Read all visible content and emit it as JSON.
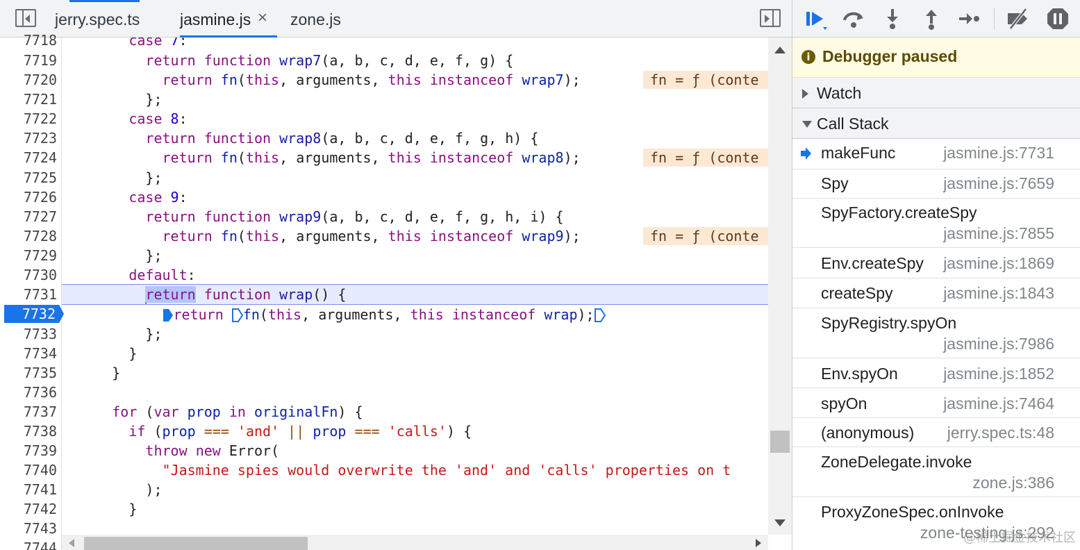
{
  "editor": {
    "tabs": [
      {
        "label": "jerry.spec.ts",
        "active": false
      },
      {
        "label": "jasmine.js",
        "active": true,
        "close": "×"
      },
      {
        "label": "zone.js",
        "active": false
      }
    ],
    "current_line": "7732",
    "lines": [
      {
        "n": "7718"
      },
      {
        "n": "7719"
      },
      {
        "n": "7720"
      },
      {
        "n": "7721"
      },
      {
        "n": "7722"
      },
      {
        "n": "7723"
      },
      {
        "n": "7724"
      },
      {
        "n": "7725"
      },
      {
        "n": "7726"
      },
      {
        "n": "7727"
      },
      {
        "n": "7728"
      },
      {
        "n": "7729"
      },
      {
        "n": "7730"
      },
      {
        "n": "7731"
      },
      {
        "n": "7732"
      },
      {
        "n": "7733"
      },
      {
        "n": "7734"
      },
      {
        "n": "7735"
      },
      {
        "n": "7736"
      },
      {
        "n": "7737"
      },
      {
        "n": "7738"
      },
      {
        "n": "7739"
      },
      {
        "n": "7740"
      },
      {
        "n": "7741"
      },
      {
        "n": "7742"
      },
      {
        "n": "7743"
      },
      {
        "n": "7744"
      }
    ],
    "inline_value": "fn = ƒ (conte",
    "code": {
      "l7718_a": "        case ",
      "l7718_b": "7",
      "l7718_c": ":",
      "l7719": {
        "indent": "          ",
        "return": "return",
        "function": "function",
        "name": "wrap7",
        "params": "(a, b, c, d, e, f, g) {"
      },
      "l7720": {
        "indent": "            ",
        "return": "return",
        "fn": "fn",
        "rest_a": "(",
        "this1": "this",
        "args": ", arguments, ",
        "this2": "this",
        "sp": " ",
        "instanceof": "instanceof",
        "sp2": " ",
        "name": "wrap7",
        "end": ");"
      },
      "l7721": "          };",
      "l7722_a": "        case ",
      "l7722_b": "8",
      "l7722_c": ":",
      "l7723": {
        "indent": "          ",
        "return": "return",
        "function": "function",
        "name": "wrap8",
        "params": "(a, b, c, d, e, f, g, h) {"
      },
      "l7724": {
        "indent": "            ",
        "return": "return",
        "fn": "fn",
        "rest_a": "(",
        "this1": "this",
        "args": ", arguments, ",
        "this2": "this",
        "sp": " ",
        "instanceof": "instanceof",
        "sp2": " ",
        "name": "wrap8",
        "end": ");"
      },
      "l7725": "          };",
      "l7726_a": "        case ",
      "l7726_b": "9",
      "l7726_c": ":",
      "l7727": {
        "indent": "          ",
        "return": "return",
        "function": "function",
        "name": "wrap9",
        "params": "(a, b, c, d, e, f, g, h, i) {"
      },
      "l7728": {
        "indent": "            ",
        "return": "return",
        "fn": "fn",
        "rest_a": "(",
        "this1": "this",
        "args": ", arguments, ",
        "this2": "this",
        "sp": " ",
        "instanceof": "instanceof",
        "sp2": " ",
        "name": "wrap9",
        "end": ");"
      },
      "l7729": "          };",
      "l7730_a": "        ",
      "l7730_b": "default",
      "l7730_c": ":",
      "l7731": {
        "indent": "          ",
        "return": "return",
        "function": "function",
        "name": "wrap",
        "params": "() {"
      },
      "l7732": {
        "indent": "            ",
        "return": "return ",
        "fn": "fn",
        "rest_a": "(",
        "this1": "this",
        "args": ", arguments, ",
        "this2": "this",
        "sp": " ",
        "instanceof": "instanceof",
        "sp2": " ",
        "name": "wrap",
        "end": ");"
      },
      "l7733": "          };",
      "l7734": "        }",
      "l7735": "      }",
      "l7737": {
        "indent": "      ",
        "for": "for",
        "p1": " (",
        "var": "var",
        "sp": " ",
        "prop": "prop",
        "sp2": " ",
        "in": "in",
        "sp3": " ",
        "obj": "originalFn",
        "end": ") {"
      },
      "l7738": {
        "indent": "        ",
        "if": "if",
        "p1": " (",
        "prop1": "prop",
        "sp": " ",
        "eq1": "===",
        "sp2": " ",
        "s1": "'and'",
        "sp3": " ",
        "or": "||",
        "sp4": " ",
        "prop2": "prop",
        "sp5": " ",
        "eq2": "===",
        "sp6": " ",
        "s2": "'calls'",
        "end": ") {"
      },
      "l7739": {
        "indent": "          ",
        "throw": "throw",
        "sp": " ",
        "new": "new",
        "rest": " Error("
      },
      "l7740": {
        "indent": "            ",
        "str": "\"Jasmine spies would overwrite the 'and' and 'calls' properties on t"
      },
      "l7741": "          );",
      "l7742": "        }"
    }
  },
  "debugger": {
    "banner": "Debugger paused",
    "watch_label": "Watch",
    "callstack_label": "Call Stack",
    "frames": [
      {
        "fn": "makeFunc",
        "loc": "jasmine.js:7731",
        "current": true
      },
      {
        "fn": "Spy",
        "loc": "jasmine.js:7659"
      },
      {
        "fn": "SpyFactory.createSpy",
        "loc": "jasmine.js:7855"
      },
      {
        "fn": "Env.createSpy",
        "loc": "jasmine.js:1869"
      },
      {
        "fn": "createSpy",
        "loc": "jasmine.js:1843"
      },
      {
        "fn": "SpyRegistry.spyOn",
        "loc": "jasmine.js:7986"
      },
      {
        "fn": "Env.spyOn",
        "loc": "jasmine.js:1852"
      },
      {
        "fn": "spyOn",
        "loc": "jasmine.js:7464"
      },
      {
        "fn": "(anonymous)",
        "loc": "jerry.spec.ts:48"
      },
      {
        "fn": "ZoneDelegate.invoke",
        "loc": "zone.js:386"
      },
      {
        "fn": "ProxyZoneSpec.onInvoke",
        "loc": "zone-testing.js:292"
      }
    ],
    "toolbar_icons": [
      "resume-icon",
      "step-over-icon",
      "step-into-icon",
      "step-out-icon",
      "step-icon",
      "deactivate-breakpoints-icon",
      "pause-on-exceptions-icon"
    ]
  },
  "watermark": "@稀土掘金技术社区",
  "colors": {
    "accent": "#1a73e8",
    "current_line_bg": "#e6ebff",
    "inline_value_bg": "#fde8d4",
    "banner_bg": "#fffbe5"
  }
}
